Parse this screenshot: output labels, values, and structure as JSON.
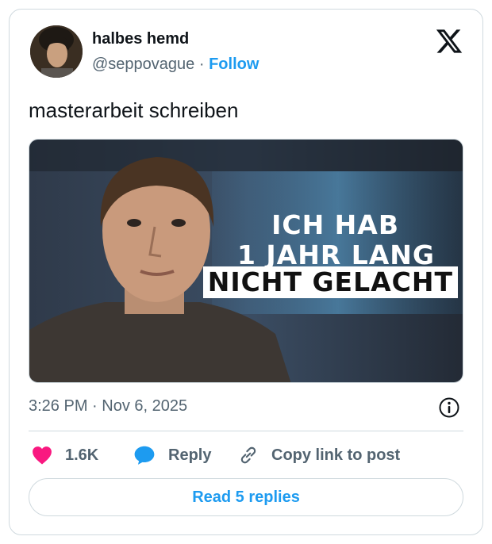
{
  "author": {
    "name": "halbes hemd",
    "handle": "@seppovague",
    "separator": "·",
    "follow_label": "Follow"
  },
  "tweet": {
    "text": "masterarbeit schreiben",
    "media_caption": [
      "ICH HAB",
      "1 JAHR LANG",
      "NICHT GELACHT"
    ],
    "timestamp": "3:26 PM · Nov 6, 2025"
  },
  "actions": {
    "likes": "1.6K",
    "reply_label": "Reply",
    "copy_label": "Copy link to post",
    "read_replies_label": "Read 5 replies"
  },
  "icons": {
    "logo": "x-logo-icon",
    "like": "heart-icon",
    "reply": "speech-bubble-icon",
    "copy": "link-icon",
    "info": "info-icon"
  },
  "colors": {
    "accent": "#1d9bf0",
    "like": "#f91880",
    "secondary_text": "#536471",
    "border": "#cfd9de"
  }
}
